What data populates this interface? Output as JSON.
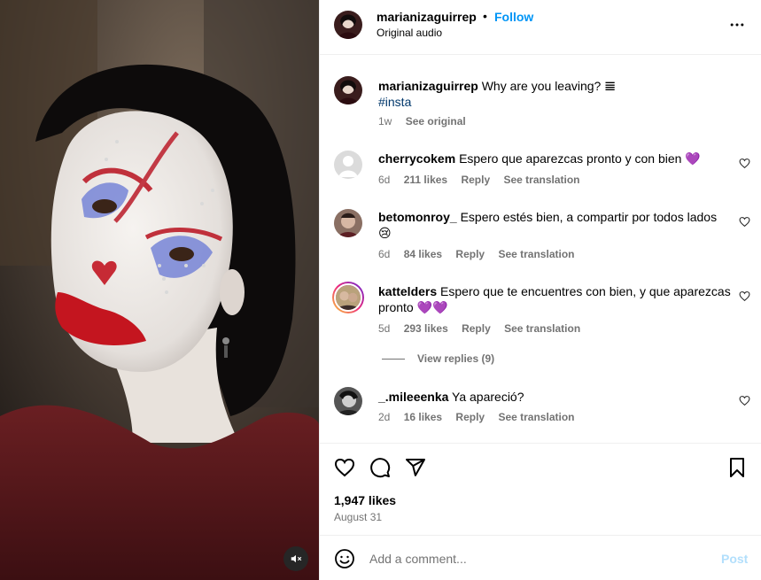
{
  "header": {
    "username": "marianizaguirrep",
    "dot": "•",
    "follow_label": "Follow",
    "audio": "Original audio",
    "more_icon": "more-horizontal-icon"
  },
  "caption": {
    "username": "marianizaguirrep",
    "text": "Why are you leaving? 𝌆",
    "hashtag": "#insta",
    "time": "1w",
    "see_original": "See original"
  },
  "comments": [
    {
      "username": "cherrycokem",
      "text": "Espero que aparezcas pronto y con bien 💜",
      "time": "6d",
      "likes": "211 likes",
      "reply": "Reply",
      "translate": "See translation"
    },
    {
      "username": "betomonroy_",
      "text": "Espero estés bien, a compartir por todos lados 😢",
      "time": "6d",
      "likes": "84 likes",
      "reply": "Reply",
      "translate": "See translation"
    },
    {
      "username": "kattelders",
      "text": "Espero que te encuentres con bien, y que aparezcas pronto 💜💜",
      "time": "5d",
      "likes": "293 likes",
      "reply": "Reply",
      "translate": "See translation"
    },
    {
      "username": "_.mileeenka",
      "text": "Ya apareció?",
      "time": "2d",
      "likes": "16 likes",
      "reply": "Reply",
      "translate": "See translation"
    }
  ],
  "view_replies": "View replies (9)",
  "actions": {
    "like_icon": "heart-icon",
    "comment_icon": "comment-icon",
    "share_icon": "share-icon",
    "save_icon": "bookmark-icon"
  },
  "likes": "1,947 likes",
  "date": "August 31",
  "comment_box": {
    "placeholder": "Add a comment...",
    "post_label": "Post",
    "emoji_icon": "emoji-icon"
  },
  "media": {
    "mute_icon": "speaker-muted-icon"
  },
  "colors": {
    "link_blue": "#0095f6",
    "post_disabled": "#b2dffc",
    "muted_text": "#737373",
    "hashtag": "#00376b"
  }
}
